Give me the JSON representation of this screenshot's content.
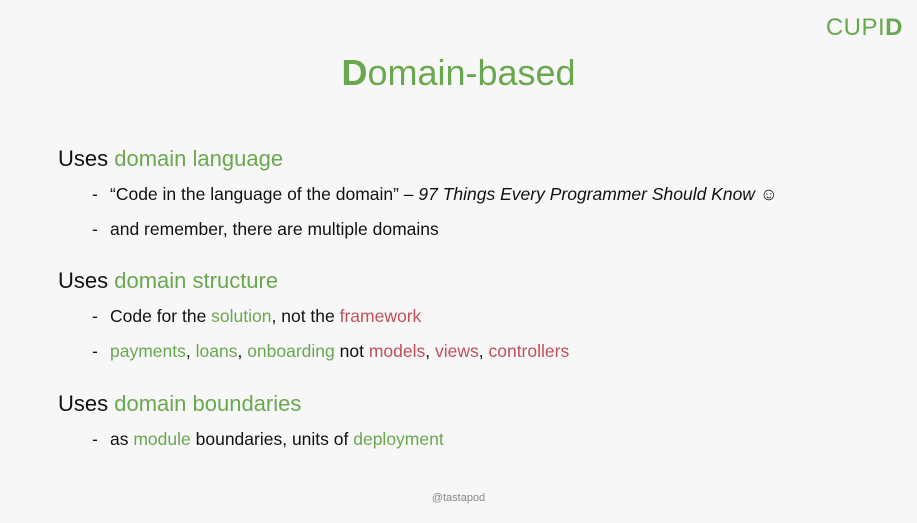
{
  "logo": {
    "prefix": "CUPI",
    "highlight": "D"
  },
  "title": {
    "first_letter": "D",
    "rest": "omain-based"
  },
  "sections": [
    {
      "heading": {
        "prefix": "Uses ",
        "term": "domain language"
      },
      "bullets": [
        {
          "quote": "“Code in the language of the domain” – ",
          "book": "97 Things Every Programmer Should Know",
          "emoji": "☺"
        },
        {
          "text": "and remember, there are multiple domains"
        }
      ]
    },
    {
      "heading": {
        "prefix": "Uses ",
        "term": "domain structure"
      },
      "bullets": [
        {
          "p1": "Code for the ",
          "g1": "solution",
          "p2": ", not the ",
          "r1": "framework"
        },
        {
          "g1": "payments",
          "s1": ", ",
          "g2": "loans",
          "s2": ", ",
          "g3": "onboarding",
          "s3": " not ",
          "r1": "models",
          "s4": ", ",
          "r2": "views",
          "s5": ", ",
          "r3": "controllers"
        }
      ]
    },
    {
      "heading": {
        "prefix": "Uses ",
        "term": "domain boundaries"
      },
      "bullets": [
        {
          "p1": "as ",
          "g1": "module",
          "p2": " boundaries, units of ",
          "g2": "deployment"
        }
      ]
    }
  ],
  "footer": "@tastapod",
  "colors": {
    "accent_green": "#6aa84f",
    "accent_red": "#c0505a",
    "background": "#f7f7f7"
  }
}
